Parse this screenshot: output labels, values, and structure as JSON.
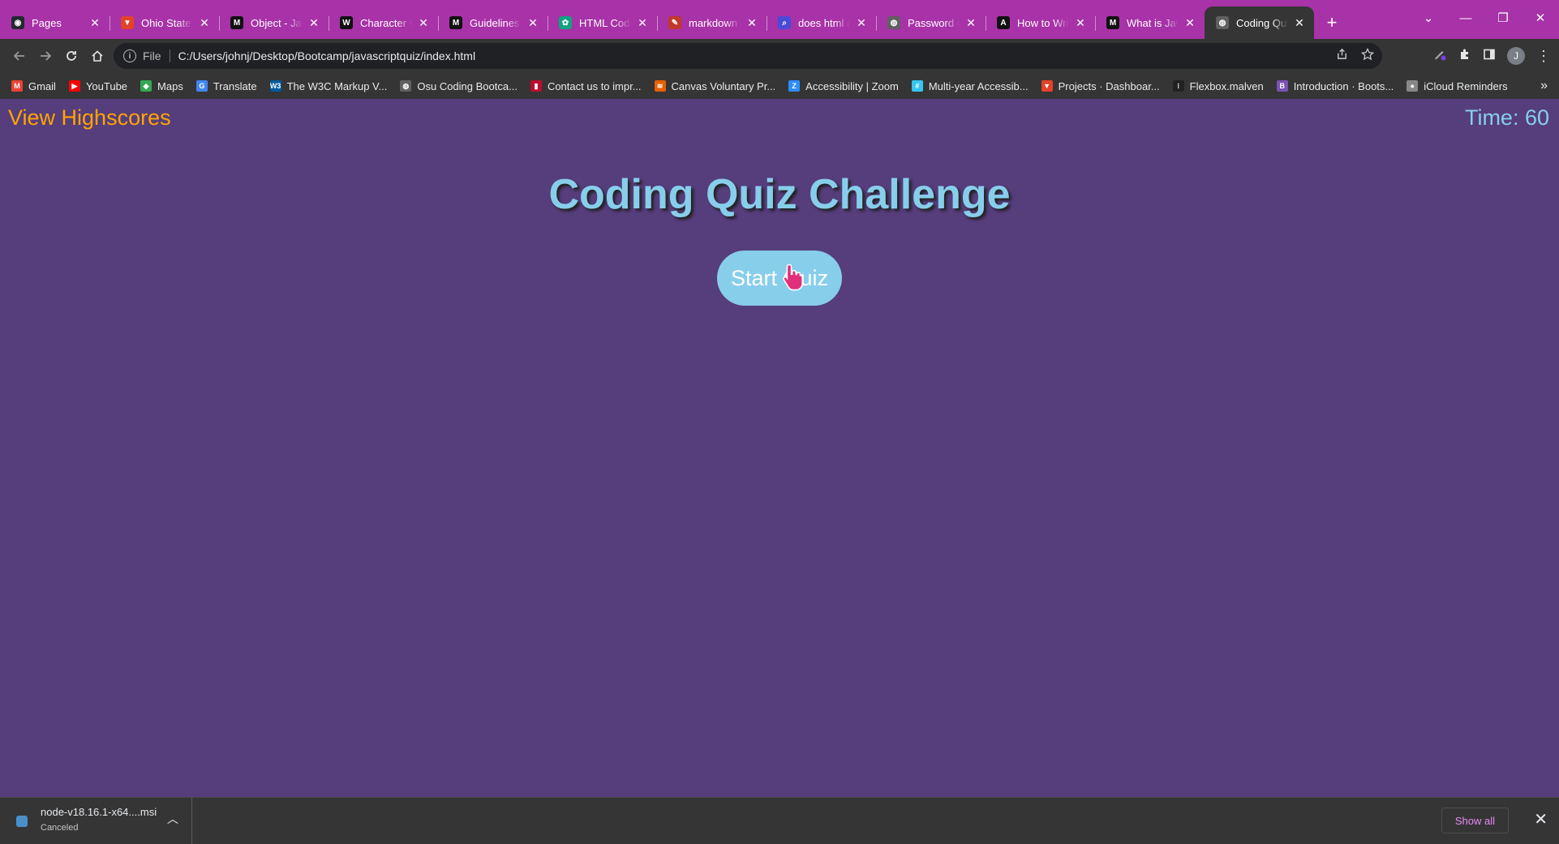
{
  "browser": {
    "tabs": [
      {
        "title": "Pages",
        "favicon": "github-icon",
        "color": "#24292f",
        "glyph": "◉",
        "active": false
      },
      {
        "title": "Ohio State University",
        "favicon": "gitlab-icon",
        "color": "#e24329",
        "glyph": "▼",
        "active": false
      },
      {
        "title": "Object - JavaScript",
        "favicon": "mdn-icon",
        "color": "#111111",
        "glyph": "M",
        "active": false
      },
      {
        "title": "Character Count",
        "favicon": "wordcounter-icon",
        "color": "#111111",
        "glyph": "W",
        "active": false
      },
      {
        "title": "Guidelines for",
        "favicon": "mdn-icon",
        "color": "#111111",
        "glyph": "M",
        "active": false
      },
      {
        "title": "HTML Coding",
        "favicon": "chatgpt-icon",
        "color": "#10a37f",
        "glyph": "✿",
        "active": false
      },
      {
        "title": "markdown - How",
        "favicon": "markdown-icon",
        "color": "#c0392b",
        "glyph": "✎",
        "active": false
      },
      {
        "title": "does html add",
        "favicon": "search-icon",
        "color": "#4a4ad8",
        "glyph": "⌕",
        "active": false
      },
      {
        "title": "Password Generator",
        "favicon": "globe-icon",
        "color": "#606060",
        "glyph": "◍",
        "active": false
      },
      {
        "title": "How to Write",
        "favicon": "ai-icon",
        "color": "#111111",
        "glyph": "A",
        "active": false
      },
      {
        "title": "What is JavaScript",
        "favicon": "mdn-icon",
        "color": "#111111",
        "glyph": "M",
        "active": false
      },
      {
        "title": "Coding Quiz",
        "favicon": "globe-icon",
        "color": "#606060",
        "glyph": "◍",
        "active": true
      }
    ],
    "new_tab": "+",
    "window_controls": {
      "tab_search": "⌄",
      "minimize": "—",
      "restore": "❐",
      "close": "✕"
    },
    "address": {
      "scheme": "File",
      "url": "C:/Users/johnj/Desktop/Bootcamp/javascriptquiz/index.html"
    },
    "profile_initial": "J",
    "bookmarks": [
      {
        "label": "Gmail",
        "icon": "gmail-icon",
        "color": "#ea4335",
        "glyph": "M"
      },
      {
        "label": "YouTube",
        "icon": "youtube-icon",
        "color": "#ff0000",
        "glyph": "▶"
      },
      {
        "label": "Maps",
        "icon": "maps-icon",
        "color": "#34a853",
        "glyph": "◆"
      },
      {
        "label": "Translate",
        "icon": "translate-icon",
        "color": "#4285f4",
        "glyph": "G"
      },
      {
        "label": "The W3C Markup V...",
        "icon": "w3c-icon",
        "color": "#005a9c",
        "glyph": "W3"
      },
      {
        "label": "Osu Coding Bootca...",
        "icon": "globe-icon",
        "color": "#606060",
        "glyph": "◍"
      },
      {
        "label": "Contact us to impr...",
        "icon": "osu-icon",
        "color": "#ba0c2f",
        "glyph": "▮"
      },
      {
        "label": "Canvas Voluntary Pr...",
        "icon": "canvas-icon",
        "color": "#e66000",
        "glyph": "≋"
      },
      {
        "label": "Accessibility | Zoom",
        "icon": "zoom-icon",
        "color": "#2d8cff",
        "glyph": "Z"
      },
      {
        "label": "Multi-year Accessib...",
        "icon": "slack-icon",
        "color": "#36c5f0",
        "glyph": "#"
      },
      {
        "label": "Projects · Dashboar...",
        "icon": "gitlab-icon",
        "color": "#e24329",
        "glyph": "▼"
      },
      {
        "label": "Flexbox.malven",
        "icon": "flexbox-icon",
        "color": "#222222",
        "glyph": "⁝"
      },
      {
        "label": "Introduction · Boots...",
        "icon": "bootstrap-icon",
        "color": "#7952b3",
        "glyph": "B"
      },
      {
        "label": "iCloud Reminders",
        "icon": "apple-icon",
        "color": "#888888",
        "glyph": "●"
      }
    ]
  },
  "page": {
    "highscores_link": "View Highscores",
    "timer": "Time: 60",
    "title": "Coding Quiz Challenge",
    "start_button": "Start Quiz"
  },
  "downloads": {
    "file_name": "node-v18.16.1-x64....msi",
    "status": "Canceled",
    "show_all": "Show all"
  },
  "colors": {
    "page_bg": "#563d7c",
    "accent_sky": "#87ceeb",
    "link_orange": "#ffa500",
    "tabstrip": "#a832a8"
  }
}
